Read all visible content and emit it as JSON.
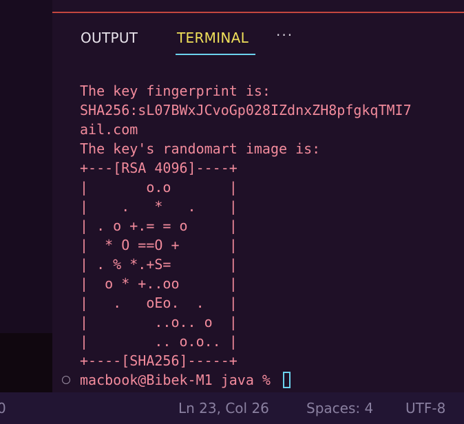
{
  "panel": {
    "tabs": [
      {
        "label": "OUTPUT",
        "active": false
      },
      {
        "label": "TERMINAL",
        "active": true
      }
    ],
    "more_icon": "more-horizontal-icon"
  },
  "terminal": {
    "lines": [
      "The key fingerprint is:",
      "SHA256:sL07BWxJCvoGp028IZdnxZH8pfgkqTMI7",
      "ail.com",
      "The key's randomart image is:",
      "+---[RSA 4096]----+",
      "|       o.o       |",
      "|    .   *   .    |",
      "| . o +.= = o     |",
      "|  * O ==O +      |",
      "| . % *.+S=       |",
      "|  o * +..oo      |",
      "|   .   oEo.  .   |",
      "|        ..o.. o  |",
      "|        .. o.o.. |",
      "+----[SHA256]-----+"
    ],
    "prompt": "macbook@Bibek-M1 java % "
  },
  "status_bar": {
    "left": "0",
    "position": "Ln 23, Col 26",
    "spaces": "Spaces: 4",
    "encoding": "UTF-8"
  },
  "colors": {
    "terminal_text": "#f28b9c",
    "active_tab": "#f0e05a",
    "active_underline": "#6bd3ee",
    "panel_border": "#c4473f",
    "background": "#1f1027"
  }
}
